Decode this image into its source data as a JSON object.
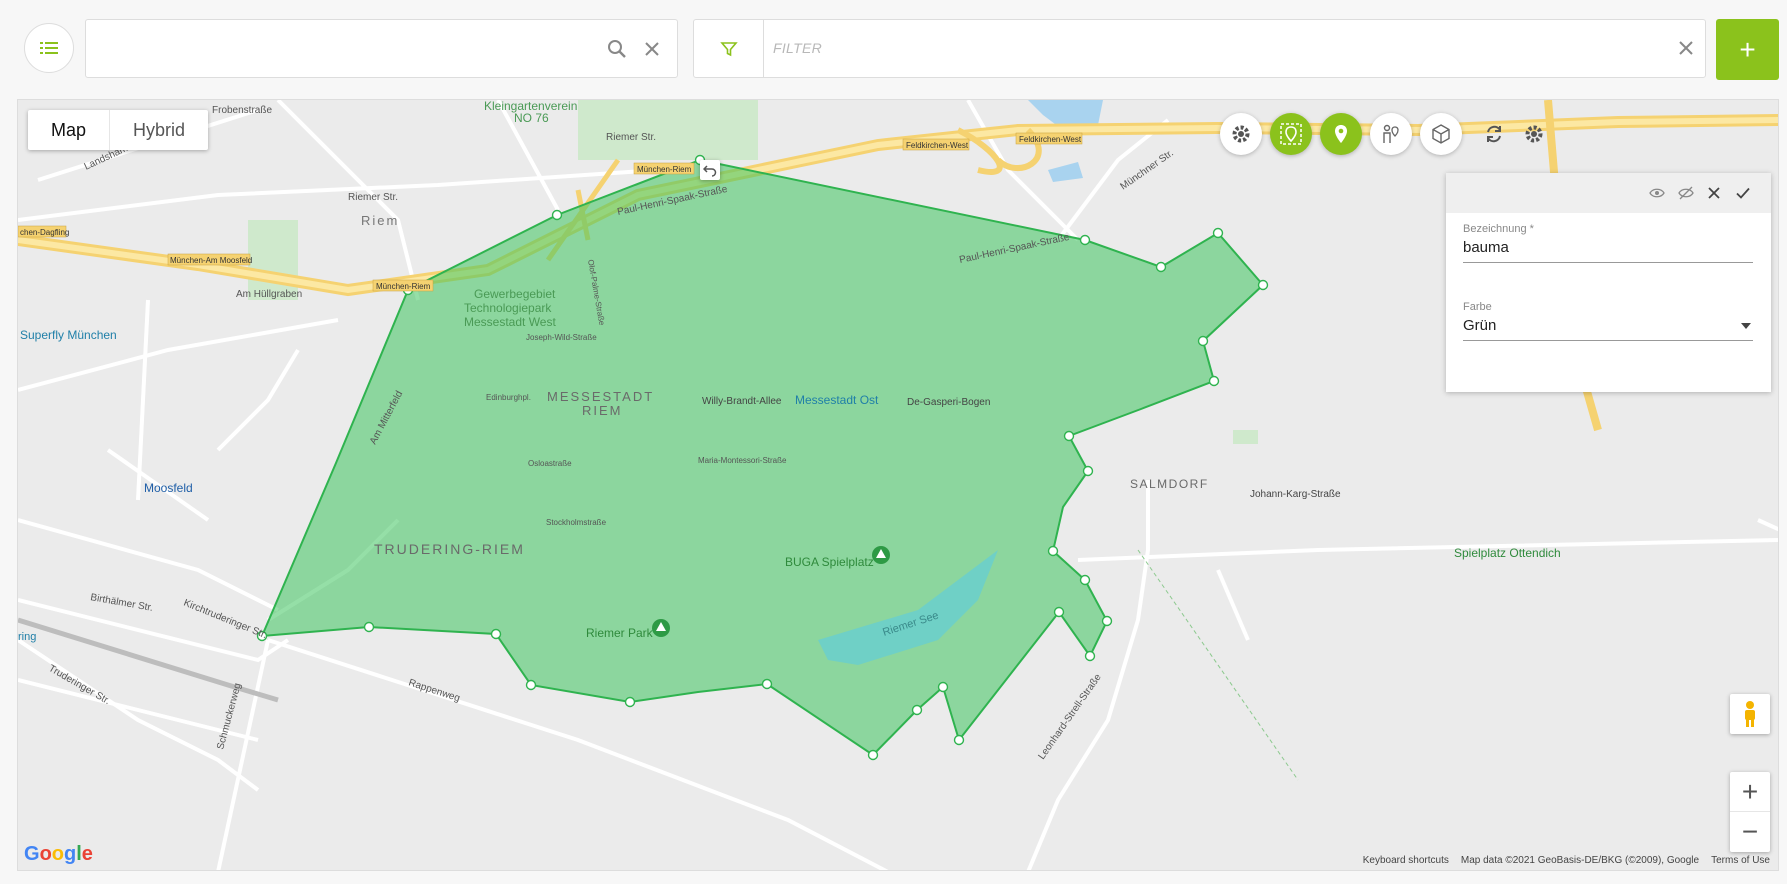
{
  "search": {
    "value": "",
    "icon": "search-icon",
    "clear_icon": "close-icon"
  },
  "filter": {
    "placeholder": "FILTER",
    "icon": "filter-icon",
    "clear_icon": "close-icon"
  },
  "add_button": {
    "label": "+"
  },
  "map": {
    "types": [
      "Map",
      "Hybrid"
    ],
    "active_type": "Map",
    "labels": {
      "kleingarten": "Kleingartenverein",
      "kleingarten2": "NO 76",
      "riemer_str": "Riemer Str.",
      "riemer_str2": "Riemer Str.",
      "riem": "Riem",
      "gewerbe1": "Gewerbegebiet",
      "gewerbe2": "Technologiepark",
      "gewerbe3": "Messestadt West",
      "messestadt1": "MESSESTADT",
      "messestadt2": "RIEM",
      "willy": "Willy-Brandt-Allee",
      "messestadt_ost": "Messestadt Ost",
      "degasperi": "De-Gasperi-Bogen",
      "trudering": "TRUDERING-RIEM",
      "buga": "BUGA Spielplatz",
      "riemer_park": "Riemer Park",
      "riemer_see": "Riemer See",
      "salmdorf": "SALMDORF",
      "johann": "Johann-Karg-Straße",
      "spielplatz": "Spielplatz Ottendich",
      "moosfeld": "Moosfeld",
      "superfly": "Superfly München",
      "frobenstrasse": "Frobenstraße",
      "landshamer": "Landshamer Str.",
      "am_huellgraben": "Am Hüllgraben",
      "paul1": "Paul-Henri-Spaak-Straße",
      "paul2": "Paul-Henri-Spaak-Straße",
      "am_mitterfeld": "Am Mitterfeld",
      "rappenweg": "Rappenweg",
      "birthaelmer": "Birthälmer Str.",
      "kirchtruderinger": "Kirchtruderinger Str.",
      "truderinger": "Truderinger Str.",
      "muenchner": "Münchner Str.",
      "leonhard": "Leonhard-Strell-Straße",
      "schmuckerweg": "Schmuckerweg",
      "feldkirchen_w1": "Feldkirchen-West",
      "feldkirchen_w2": "Feldkirchen-West",
      "muenchen_riem": "München-Riem",
      "muenchen_riem2": "München-Riem",
      "muenchen_am_moosfeld": "München-Am Moosfeld",
      "muenchen_dagfling": "chen-Dagfling",
      "mariamontessori": "Maria-Montessori-Straße",
      "joseph": "Joseph-Wild-Straße",
      "olof": "Olof-Palme-Straße",
      "edinburgh": "Edinburghpl.",
      "oslo": "Osloastraße",
      "stockholm": "Stockholmstraße",
      "ring": "ring"
    },
    "keyboard_shortcuts": "Keyboard shortcuts",
    "map_data": "Map data ©2021 GeoBasis-DE/BKG (©2009), Google",
    "terms": "Terms of Use",
    "google": "Google",
    "zoom_in": "+",
    "zoom_out": "−"
  },
  "panel": {
    "bezeichnung_label": "Bezeichnung *",
    "bezeichnung_value": "bauma",
    "farbe_label": "Farbe",
    "farbe_value": "Grün"
  },
  "colors": {
    "accent": "#8bc21c",
    "polygon_fill": "#3ec45e",
    "polygon_stroke": "#2fb34f"
  }
}
